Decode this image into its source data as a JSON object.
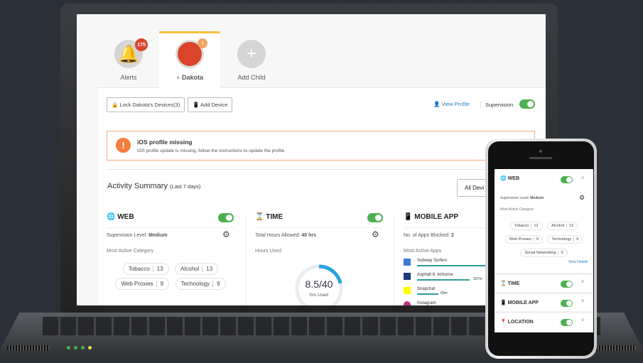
{
  "tabs": [
    {
      "label": "Alerts",
      "badge": "175",
      "icon": "bell-icon"
    },
    {
      "label": "Dakota",
      "badge": "!",
      "icon": "avatar"
    },
    {
      "label": "Add Child",
      "icon": "plus-icon"
    }
  ],
  "toolbar": {
    "lock_label": "Lock Dakota's Devices(3)",
    "add_device_label": "Add Device",
    "view_profile_label": "View Profile",
    "supervision_label": "Supervision",
    "supervision_on": true
  },
  "alert": {
    "title": "iOS profile missing",
    "message": "iOS profile update is missing, follow the instructions to update the profile."
  },
  "activity": {
    "title": "Activity Summary",
    "period": "(Last 7 days)",
    "device_filter": "All Devi"
  },
  "web": {
    "title": "WEB",
    "level_label": "Supervision Level:",
    "level": "Medium",
    "category_label": "Most Active Category",
    "categories": [
      {
        "name": "Tobacco",
        "count": "13"
      },
      {
        "name": "Alcohol",
        "count": "13"
      },
      {
        "name": "Web Proxies",
        "count": "9"
      },
      {
        "name": "Technology",
        "count": "9"
      },
      {
        "name": "Social Networking",
        "count": "9"
      }
    ],
    "view_details": "View Details"
  },
  "time": {
    "title": "TIME",
    "allowed_label": "Total Hours Allowed:",
    "allowed": "40 hrs",
    "used_label": "Hours Used",
    "used": "8.5/40",
    "used_unit": "hrs Used",
    "fraction": 0.2125
  },
  "mobile": {
    "title": "MOBILE APP",
    "blocked_label": "No. of Apps Blocked:",
    "blocked": "2",
    "apps_label": "Most Active Apps",
    "apps": [
      {
        "name": "Subway Surfers",
        "time": ""
      },
      {
        "name": "Asphalt 8: Airborne",
        "time": "157m"
      },
      {
        "name": "Snapchat",
        "time": "60m"
      },
      {
        "name": "Instagram",
        "time": ""
      }
    ]
  },
  "phone": {
    "sections": [
      "TIME",
      "MOBILE APP",
      "LOCATION"
    ]
  },
  "colors": {
    "toggle": "#4caf50",
    "accent_tab": "#f5c242",
    "alert": "#f47c3c",
    "badge": "#d9442b",
    "link": "#1f7fc4",
    "progress": "#29a3e0"
  }
}
